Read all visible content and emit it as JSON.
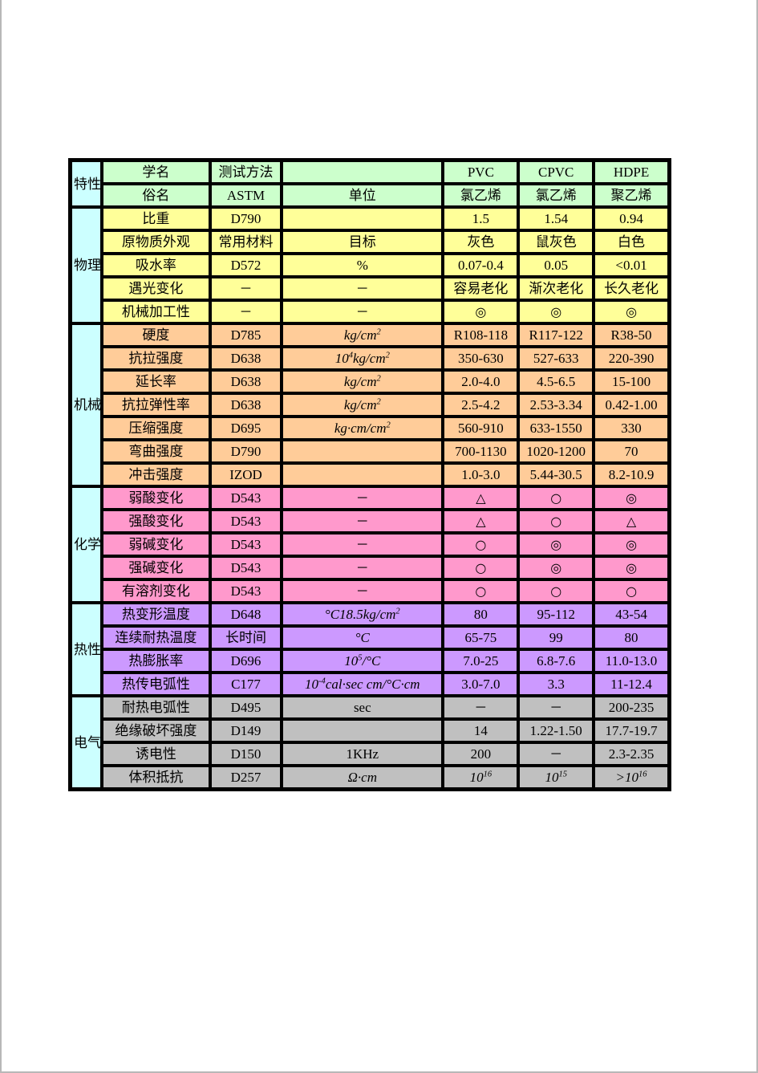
{
  "table": {
    "columns": {
      "group": "特性",
      "header_row1": {
        "property": "学名",
        "method": "测试方法",
        "unit": "",
        "values": [
          "PVC",
          "CPVC",
          "HDPE"
        ]
      },
      "header_row2": {
        "property": "俗名",
        "method": "ASTM",
        "unit": "单位",
        "values": [
          "氯乙烯",
          "氯乙烯",
          "聚乙烯"
        ]
      }
    },
    "sections": [
      {
        "group": "物理性质",
        "color": "#FFFF99",
        "rows": [
          {
            "property": "比重",
            "method": "D790",
            "unit": "",
            "values": [
              "1.5",
              "1.54",
              "0.94"
            ]
          },
          {
            "property": "原物质外观",
            "method": "常用材料",
            "unit": "目标",
            "values": [
              "灰色",
              "鼠灰色",
              "白色"
            ]
          },
          {
            "property": "吸水率",
            "method": "D572",
            "unit": "%",
            "values": [
              "0.07-0.4",
              "0.05",
              "<0.01"
            ]
          },
          {
            "property": "遇光变化",
            "method": "－",
            "unit": "－",
            "values": [
              "容易老化",
              "渐次老化",
              "长久老化"
            ]
          },
          {
            "property": "机械加工性",
            "method": "－",
            "unit": "－",
            "values": [
              "◎",
              "◎",
              "◎"
            ]
          }
        ]
      },
      {
        "group": "机械性质",
        "color": "#FFCC99",
        "rows": [
          {
            "property": "硬度",
            "method": "D785",
            "unit": "kg/cm²",
            "values": [
              "R108-118",
              "R117-122",
              "R38-50"
            ]
          },
          {
            "property": "抗拉强度",
            "method": "D638",
            "unit": "10⁴kg/cm²",
            "values": [
              "350-630",
              "527-633",
              "220-390"
            ]
          },
          {
            "property": "延长率",
            "method": "D638",
            "unit": "kg/cm²",
            "values": [
              "2.0-4.0",
              "4.5-6.5",
              "15-100"
            ]
          },
          {
            "property": "抗拉弹性率",
            "method": "D638",
            "unit": "kg/cm²",
            "values": [
              "2.5-4.2",
              "2.53-3.34",
              "0.42-1.00"
            ]
          },
          {
            "property": "压缩强度",
            "method": "D695",
            "unit": "kg·cm/cm²",
            "values": [
              "560-910",
              "633-1550",
              "330"
            ]
          },
          {
            "property": "弯曲强度",
            "method": "D790",
            "unit": "",
            "values": [
              "700-1130",
              "1020-1200",
              "70"
            ]
          },
          {
            "property": "冲击强度",
            "method": "IZOD",
            "unit": "",
            "values": [
              "1.0-3.0",
              "5.44-30.5",
              "8.2-10.9"
            ]
          }
        ]
      },
      {
        "group": "化学性质",
        "color": "#FF99CC",
        "rows": [
          {
            "property": "弱酸变化",
            "method": "D543",
            "unit": "－",
            "values": [
              "△",
              "○",
              "◎"
            ]
          },
          {
            "property": "强酸变化",
            "method": "D543",
            "unit": "－",
            "values": [
              "△",
              "○",
              "△"
            ]
          },
          {
            "property": "弱碱变化",
            "method": "D543",
            "unit": "－",
            "values": [
              "○",
              "◎",
              "◎"
            ]
          },
          {
            "property": "强碱变化",
            "method": "D543",
            "unit": "－",
            "values": [
              "○",
              "◎",
              "◎"
            ]
          },
          {
            "property": "有溶剂变化",
            "method": "D543",
            "unit": "－",
            "values": [
              "○",
              "○",
              "○"
            ]
          }
        ]
      },
      {
        "group": "热性质",
        "color": "#CC99FF",
        "rows": [
          {
            "property": "热变形温度",
            "method": "D648",
            "unit": "°C18.5kg/cm²",
            "values": [
              "80",
              "95-112",
              "43-54"
            ]
          },
          {
            "property": "连续耐热温度",
            "method": "长时间",
            "unit": "°C",
            "values": [
              "65-75",
              "99",
              "80"
            ]
          },
          {
            "property": "热膨胀率",
            "method": "D696",
            "unit": "10⁵/°C",
            "values": [
              "7.0-25",
              "6.8-7.6",
              "11.0-13.0"
            ]
          },
          {
            "property": "热传电弧性",
            "method": "C177",
            "unit": "10⁻⁴cal·sec cm/°C·cm",
            "values": [
              "3.0-7.0",
              "3.3",
              "11-12.4"
            ]
          }
        ]
      },
      {
        "group": "电气性质",
        "color": "#C0C0C0",
        "rows": [
          {
            "property": "耐热电弧性",
            "method": "D495",
            "unit": "sec",
            "values": [
              "－",
              "－",
              "200-235"
            ]
          },
          {
            "property": "绝缘破坏强度",
            "method": "D149",
            "unit": "",
            "values": [
              "14",
              "1.22-1.50",
              "17.7-19.7"
            ]
          },
          {
            "property": "诱电性",
            "method": "D150",
            "unit": "1KHz",
            "values": [
              "200",
              "－",
              "2.3-2.35"
            ]
          },
          {
            "property": "体积抵抗",
            "method": "D257",
            "unit": "Ω·cm",
            "values": [
              "10¹⁶",
              "10¹⁵",
              ">10¹⁶"
            ]
          }
        ]
      }
    ]
  }
}
